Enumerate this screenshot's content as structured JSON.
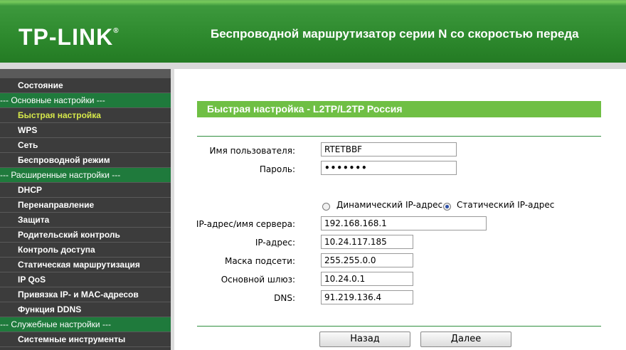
{
  "header": {
    "logo": "TP-LINK",
    "logo_mark": "®",
    "slogan": "Беспроводной маршрутизатор серии N со скоростью переда"
  },
  "sidebar": {
    "items": [
      {
        "type": "item",
        "label": "Состояние"
      },
      {
        "type": "section",
        "label": "--- Основные настройки ---"
      },
      {
        "type": "item",
        "label": "Быстрая настройка",
        "active": true
      },
      {
        "type": "item",
        "label": "WPS"
      },
      {
        "type": "item",
        "label": "Сеть"
      },
      {
        "type": "item",
        "label": "Беспроводной режим"
      },
      {
        "type": "section",
        "label": "--- Расширенные настройки ---"
      },
      {
        "type": "item",
        "label": "DHCP"
      },
      {
        "type": "item",
        "label": "Перенаправление"
      },
      {
        "type": "item",
        "label": "Защита"
      },
      {
        "type": "item",
        "label": "Родительский контроль"
      },
      {
        "type": "item",
        "label": "Контроль доступа"
      },
      {
        "type": "item",
        "label": "Статическая маршрутизация"
      },
      {
        "type": "item",
        "label": "IP QoS"
      },
      {
        "type": "item",
        "label": "Привязка IP- и MAC-адресов"
      },
      {
        "type": "item",
        "label": "Функция DDNS"
      },
      {
        "type": "section",
        "label": "--- Служебные настройки ---"
      },
      {
        "type": "item",
        "label": "Системные инструменты"
      }
    ]
  },
  "page": {
    "title": "Быстрая настройка - L2TP/L2TP Россия",
    "username_label": "Имя пользователя:",
    "username_value": "RTETBBF",
    "password_label": "Пароль:",
    "password_value": "•••••••",
    "radio_dynamic": "Динамический IP-адрес",
    "radio_static": "Статический IP-адрес",
    "server_label": "IP-адрес/имя сервера:",
    "server_value": "192.168.168.1",
    "ip_label": "IP-адрес:",
    "ip_value": "10.24.117.185",
    "mask_label": "Маска подсети:",
    "mask_value": "255.255.0.0",
    "gateway_label": "Основной шлюз:",
    "gateway_value": "10.24.0.1",
    "dns_label": "DNS:",
    "dns_value": "91.219.136.4",
    "back_button": "Назад",
    "next_button": "Далее"
  },
  "colors": {
    "header_green": "#2e8a2e",
    "title_bar": "#6fbf44",
    "sidebar_bg": "#3c3c3c",
    "section_bg": "#1f7a3c",
    "active_item": "#d6e84a"
  }
}
